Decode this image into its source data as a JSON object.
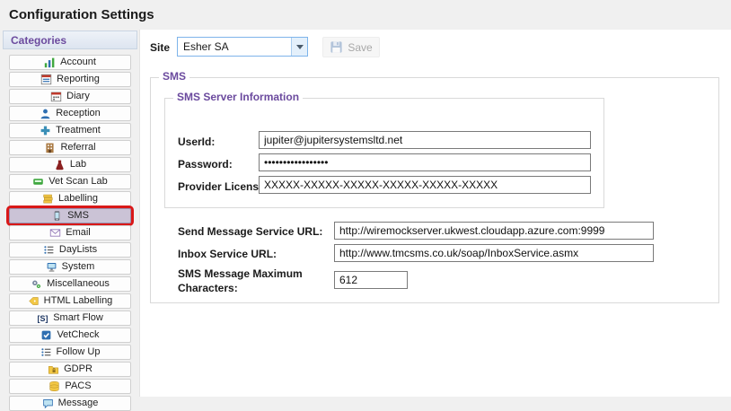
{
  "window": {
    "title": "Configuration Settings"
  },
  "sidebar": {
    "header": "Categories",
    "items": [
      {
        "label": "Account",
        "icon": "bar-chart-icon"
      },
      {
        "label": "Reporting",
        "icon": "report-icon"
      },
      {
        "label": "Diary",
        "icon": "calendar-icon"
      },
      {
        "label": "Reception",
        "icon": "person-icon"
      },
      {
        "label": "Treatment",
        "icon": "medical-cross-icon"
      },
      {
        "label": "Referral",
        "icon": "building-icon"
      },
      {
        "label": "Lab",
        "icon": "flask-icon"
      },
      {
        "label": "Vet Scan Lab",
        "icon": "scanner-icon"
      },
      {
        "label": "Labelling",
        "icon": "labels-icon"
      },
      {
        "label": "SMS",
        "icon": "mobile-phone-icon",
        "selected": true
      },
      {
        "label": "Email",
        "icon": "envelope-icon"
      },
      {
        "label": "DayLists",
        "icon": "list-icon"
      },
      {
        "label": "System",
        "icon": "monitor-icon"
      },
      {
        "label": "Miscellaneous",
        "icon": "gears-icon"
      },
      {
        "label": "HTML Labelling",
        "icon": "tag-icon"
      },
      {
        "label": "Smart Flow",
        "icon": "smartflow-icon"
      },
      {
        "label": "VetCheck",
        "icon": "check-square-icon"
      },
      {
        "label": "Follow Up",
        "icon": "list-icon"
      },
      {
        "label": "GDPR",
        "icon": "folder-lock-icon"
      },
      {
        "label": "PACS",
        "icon": "database-icon"
      },
      {
        "label": "Message",
        "icon": "speech-bubble-icon"
      }
    ]
  },
  "toolbar": {
    "site_label": "Site",
    "site_value": "Esher SA",
    "save_label": "Save"
  },
  "form": {
    "group_title": "SMS",
    "server_info": {
      "title": "SMS Server Information",
      "userid_label": "UserId:",
      "userid_value": "jupiter@jupitersystemsltd.net",
      "password_label": "Password:",
      "password_value": "•••••••••••••••••",
      "license_label": "Provider License:",
      "license_value": "XXXXX-XXXXX-XXXXX-XXXXX-XXXXX-XXXXX"
    },
    "send_url_label": "Send Message Service URL:",
    "send_url_value": "http://wiremockserver.ukwest.cloudapp.azure.com:9999",
    "inbox_url_label": "Inbox Service URL:",
    "inbox_url_value": "http://www.tmcsms.co.uk/soap/InboxService.asmx",
    "max_chars_label": "SMS Message Maximum Characters:",
    "max_chars_value": "612"
  },
  "colors": {
    "accent_purple": "#6b4a9e",
    "selected_highlight_border": "#d91818"
  }
}
